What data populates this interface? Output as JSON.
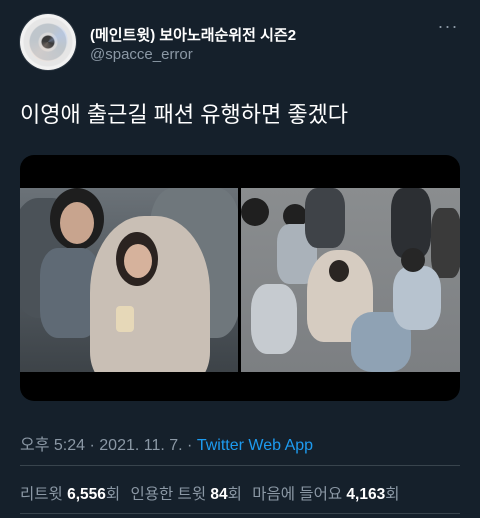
{
  "tweet": {
    "author_name": "(메인트윗) 보아노래순위전 시즌2",
    "author_handle": "@spacce_error",
    "text": "이영애 출근길 패션 유행하면 좋겠다",
    "more_icon": "ellipsis-icon",
    "time": "오후 5:24",
    "date": "2021. 11. 7.",
    "separator": "·",
    "source_app": "Twitter Web App",
    "stats": {
      "retweets_label": "리트윗",
      "retweets_value": "6,556",
      "retweets_unit": "회",
      "quotes_label": "인용한 트윗",
      "quotes_value": "84",
      "quotes_unit": "회",
      "likes_label": "마음에 들어요",
      "likes_value": "4,163",
      "likes_unit": "회"
    }
  },
  "colors": {
    "background": "#15202b",
    "text": "#ffffff",
    "muted": "#8b98a5",
    "link": "#1d9bf0"
  }
}
